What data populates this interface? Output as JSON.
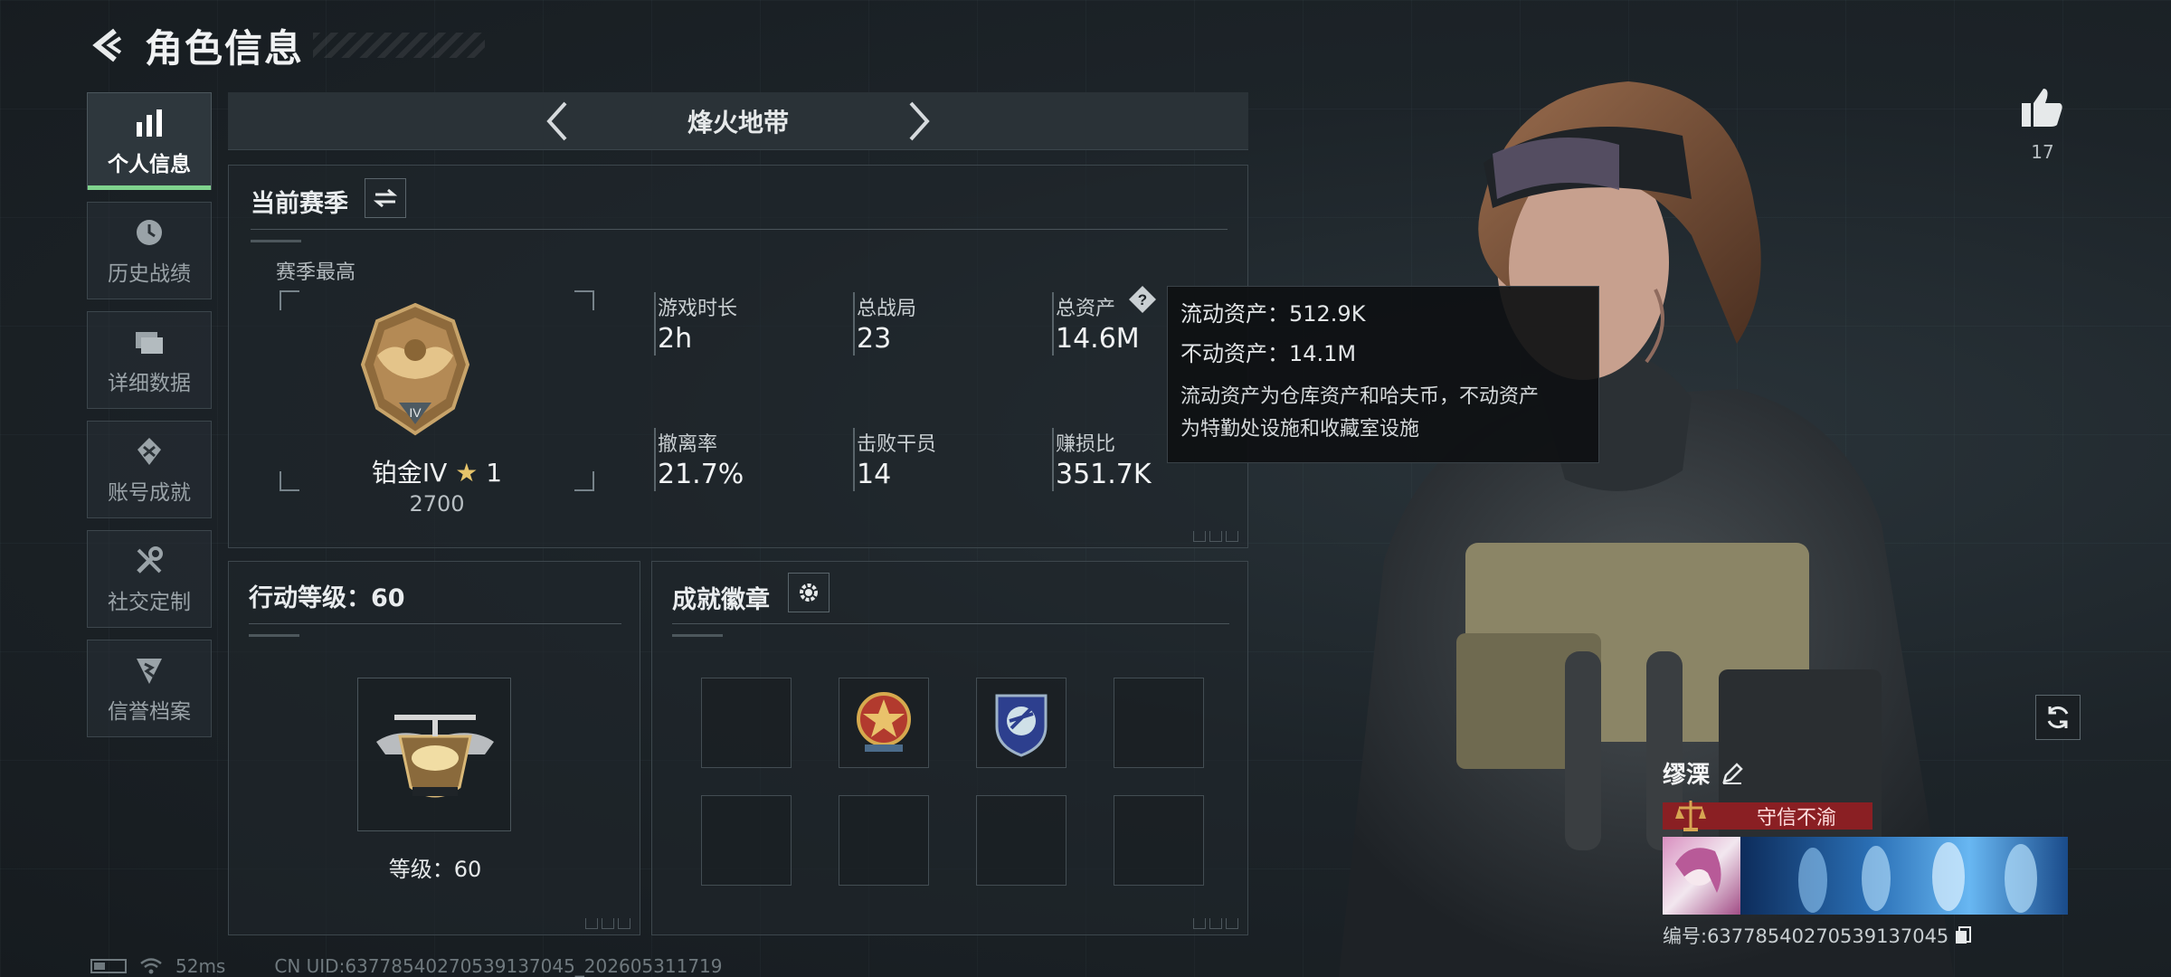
{
  "header": {
    "title": "角色信息"
  },
  "sidebar": {
    "items": [
      {
        "label": "个人信息",
        "icon": "bar-chart-icon",
        "active": true
      },
      {
        "label": "历史战绩",
        "icon": "clock-icon",
        "active": false
      },
      {
        "label": "详细数据",
        "icon": "folder-icon",
        "active": false
      },
      {
        "label": "账号成就",
        "icon": "medal-icon",
        "active": false
      },
      {
        "label": "社交定制",
        "icon": "wrench-icon",
        "active": false
      },
      {
        "label": "信誉档案",
        "icon": "shield-icon",
        "active": false
      }
    ]
  },
  "mode": {
    "title": "烽火地带"
  },
  "season": {
    "heading": "当前赛季",
    "best_label": "赛季最高",
    "rank_name": "铂金IV",
    "rank_stars": "1",
    "rank_score": "2700",
    "stats": [
      {
        "label": "游戏时长",
        "value": "2h"
      },
      {
        "label": "总战局",
        "value": "23"
      },
      {
        "label": "总资产",
        "value": "14.6M"
      },
      {
        "label": "撤离率",
        "value": "21.7%"
      },
      {
        "label": "击败干员",
        "value": "14"
      },
      {
        "label": "赚损比",
        "value": "351.7K"
      }
    ]
  },
  "tooltip": {
    "liquid": "流动资产：512.9K",
    "fixed": "不动资产：14.1M",
    "desc_1": "流动资产为仓库资产和哈夫币，不动资产",
    "desc_2": "为特勤处设施和收藏室设施"
  },
  "level": {
    "heading": "行动等级：60",
    "text": "等级：60"
  },
  "badges": {
    "heading": "成就徽章"
  },
  "like": {
    "count": "17"
  },
  "player": {
    "name": "缪溧",
    "credit": "守信不渝",
    "id_text": "编号:6377854027053913704​5"
  },
  "footer": {
    "ping": "52ms",
    "uid": "CN UID:6377854027053913704​5_202605311719"
  },
  "colors": {
    "accent_green": "#7fd38d",
    "credit_red": "#8a1f23"
  }
}
